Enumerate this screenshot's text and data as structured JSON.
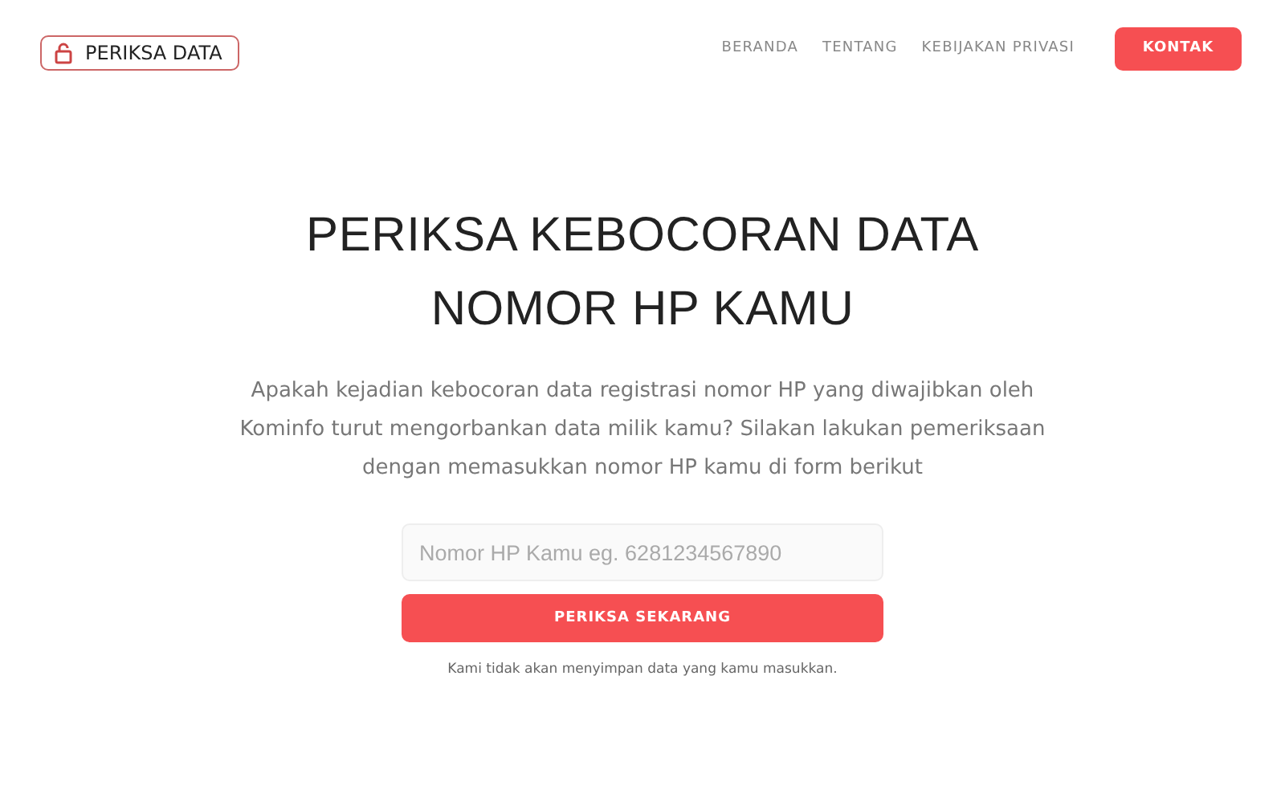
{
  "logo": {
    "label": "PERIKSA DATA"
  },
  "nav": {
    "links": [
      "BERANDA",
      "TENTANG",
      "KEBIJAKAN PRIVASI"
    ],
    "cta": "KONTAK"
  },
  "hero": {
    "title_lines": [
      "PERIKSA KEBOCORAN DATA",
      "NOMOR HP KAMU"
    ],
    "description_lines": [
      "Apakah kejadian kebocoran data registrasi nomor HP yang diwajibkan oleh",
      "Kominfo turut mengorbankan data milik kamu? Silakan lakukan pemeriksaan",
      "dengan memasukkan nomor HP kamu di form berikut"
    ]
  },
  "form": {
    "placeholder": "Nomor HP Kamu eg. 6281234567890",
    "button": "PERIKSA SEKARANG",
    "note": "Kami tidak akan menyimpan data yang kamu masukkan."
  }
}
